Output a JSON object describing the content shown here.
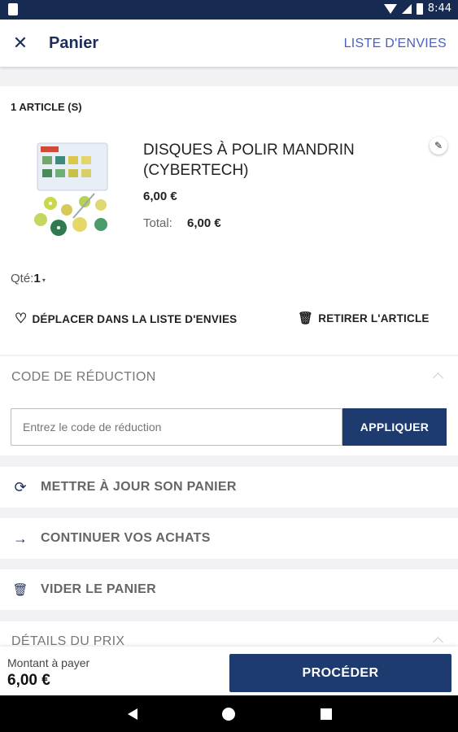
{
  "status_bar": {
    "time": "8:44"
  },
  "app_bar": {
    "title": "Panier",
    "wishlist_link": "LISTE D'ENVIES"
  },
  "cart": {
    "count_label": "1 ARTICLE (S)",
    "item": {
      "name": "DISQUES À POLIR MANDRIN (CYBERTECH)",
      "price": "6,00 €",
      "total_label": "Total:",
      "total_value": "6,00 €",
      "qty_label": "Qté:",
      "qty_value": "1"
    },
    "move_to_wishlist": "DÉPLACER DANS LA LISTE D'ENVIES",
    "remove_item": "RETIRER L'ARTICLE"
  },
  "coupon": {
    "title": "CODE DE RÉDUCTION",
    "placeholder": "Entrez le code de réduction",
    "apply_label": "APPLIQUER"
  },
  "actions": {
    "update_cart": "METTRE À JOUR SON PANIER",
    "continue_shopping": "CONTINUER VOS ACHATS",
    "empty_cart": "VIDER LE PANIER"
  },
  "price_details": {
    "title": "DÉTAILS DU PRIX"
  },
  "footer": {
    "amount_label": "Montant à payer",
    "amount_value": "6,00 €",
    "proceed_label": "PROCÉDER"
  },
  "icons": {
    "close": "close-icon",
    "edit": "pencil-icon",
    "wishlist": "heart-icon",
    "remove": "trash-icon",
    "update": "refresh-icon",
    "continue": "arrow-right-icon",
    "empty": "trash-icon"
  },
  "colors": {
    "primary": "#1e3b70",
    "status_bar": "#162a52",
    "link": "#4a5fc1"
  }
}
